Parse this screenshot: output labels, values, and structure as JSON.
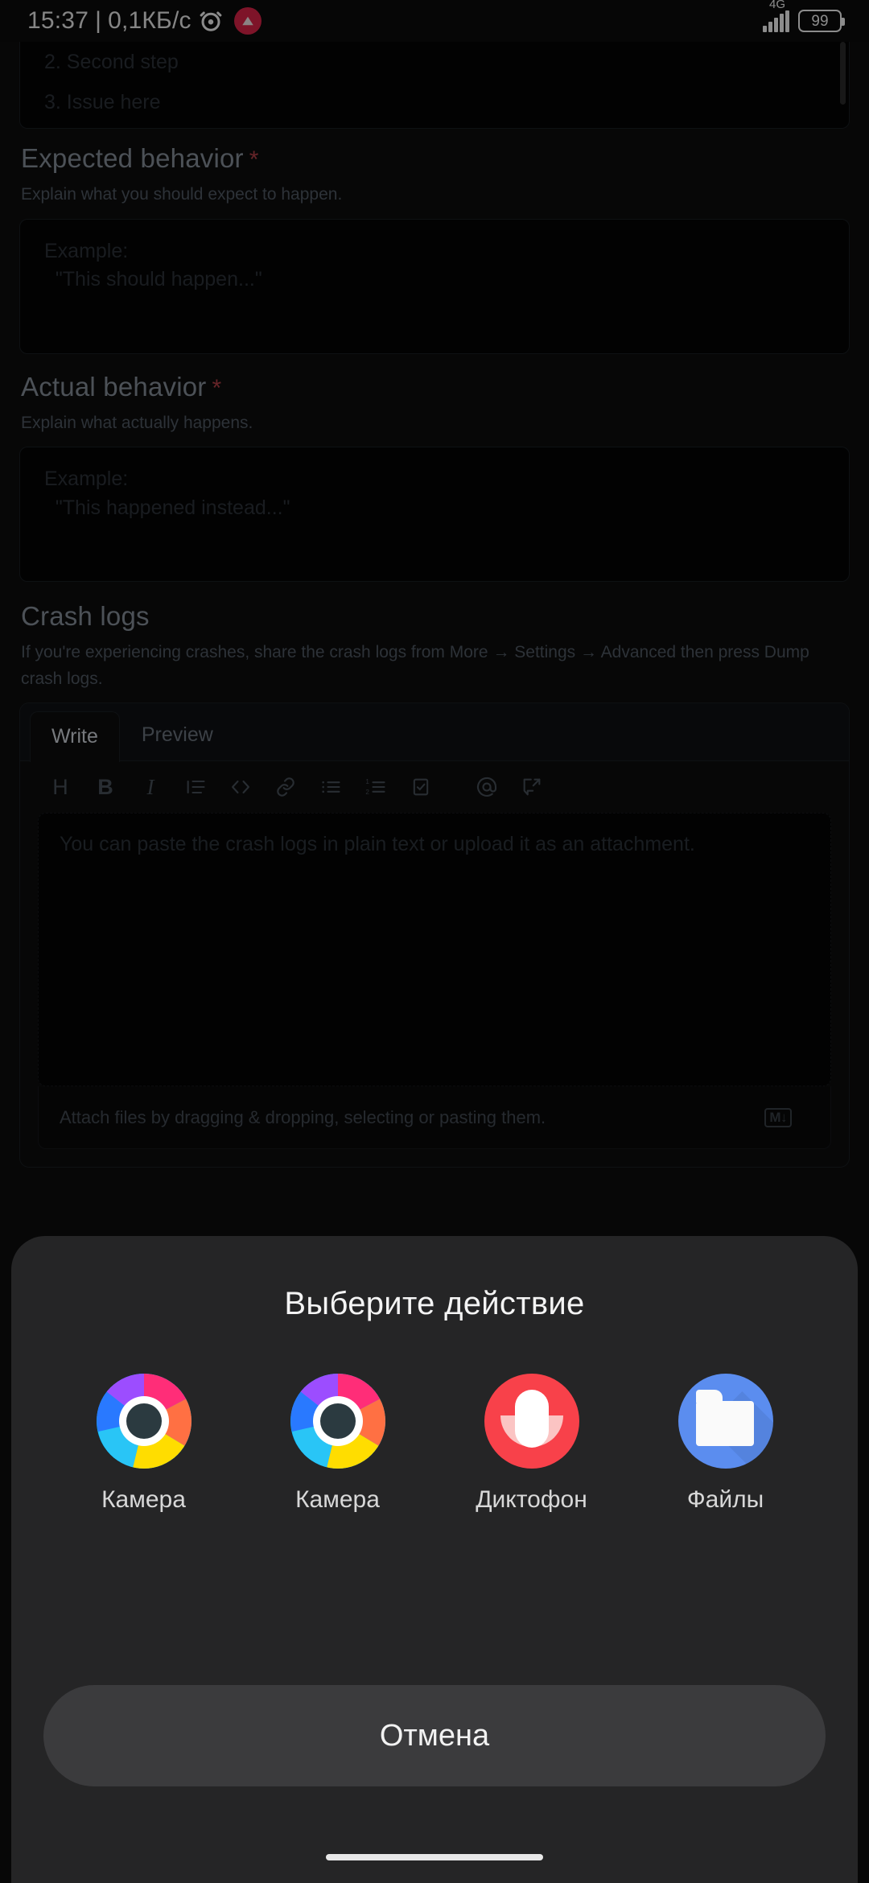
{
  "status_bar": {
    "clock": "15:37",
    "separator": "|",
    "net_speed": "0,1КБ/с",
    "alarm_icon": "alarm-clock-icon",
    "notification_icon": "app-notification-badge",
    "network_type": "4G",
    "signal_icon": "signal-bars-icon",
    "battery_level": "99"
  },
  "form": {
    "steps_area": {
      "lines": [
        "2. Second step",
        "3. Issue here"
      ]
    },
    "expected": {
      "title": "Expected behavior",
      "required_mark": "*",
      "description": "Explain what you should expect to happen.",
      "placeholder": "Example:\n  \"This should happen...\""
    },
    "actual": {
      "title": "Actual behavior",
      "required_mark": "*",
      "description": "Explain what actually happens.",
      "placeholder": "Example:\n  \"This happened instead...\""
    },
    "crash_logs": {
      "title": "Crash logs",
      "description": "If you're experiencing crashes, share the crash logs from More → Settings → Advanced then press Dump crash logs.",
      "tabs": [
        {
          "label": "Write",
          "active": true
        },
        {
          "label": "Preview",
          "active": false
        }
      ],
      "toolbar": [
        {
          "name": "heading-icon",
          "glyph": "H"
        },
        {
          "name": "bold-icon",
          "glyph": "B"
        },
        {
          "name": "italic-icon",
          "glyph": "I"
        },
        {
          "name": "quote-icon",
          "glyph": "quote"
        },
        {
          "name": "code-icon",
          "glyph": "<>"
        },
        {
          "name": "link-icon",
          "glyph": "link"
        },
        {
          "name": "unordered-list-icon",
          "glyph": "ul"
        },
        {
          "name": "ordered-list-icon",
          "glyph": "ol"
        },
        {
          "name": "task-list-icon",
          "glyph": "task"
        },
        {
          "name": "mention-icon",
          "glyph": "@"
        },
        {
          "name": "reference-icon",
          "glyph": "ref"
        }
      ],
      "editor_placeholder": "You can paste the crash logs in plain text or upload it as an attachment.",
      "attach_hint": "Attach files by dragging & dropping, selecting or pasting them.",
      "markdown_badge": "M↓"
    }
  },
  "sheet": {
    "title": "Выберите действие",
    "apps": [
      {
        "label": "Камера",
        "icon": "camera-aperture-icon"
      },
      {
        "label": "Камера",
        "icon": "camera-aperture-icon"
      },
      {
        "label": "Диктофон",
        "icon": "voice-recorder-icon"
      },
      {
        "label": "Файлы",
        "icon": "files-folder-icon"
      }
    ],
    "cancel_label": "Отмена"
  },
  "colors": {
    "background": "#0d0d0d",
    "sheet": "#252526",
    "accent_red": "#f8414a",
    "accent_blue": "#5b8def",
    "required_star": "#b9424a",
    "cancel_button": "#3b3b3d"
  }
}
